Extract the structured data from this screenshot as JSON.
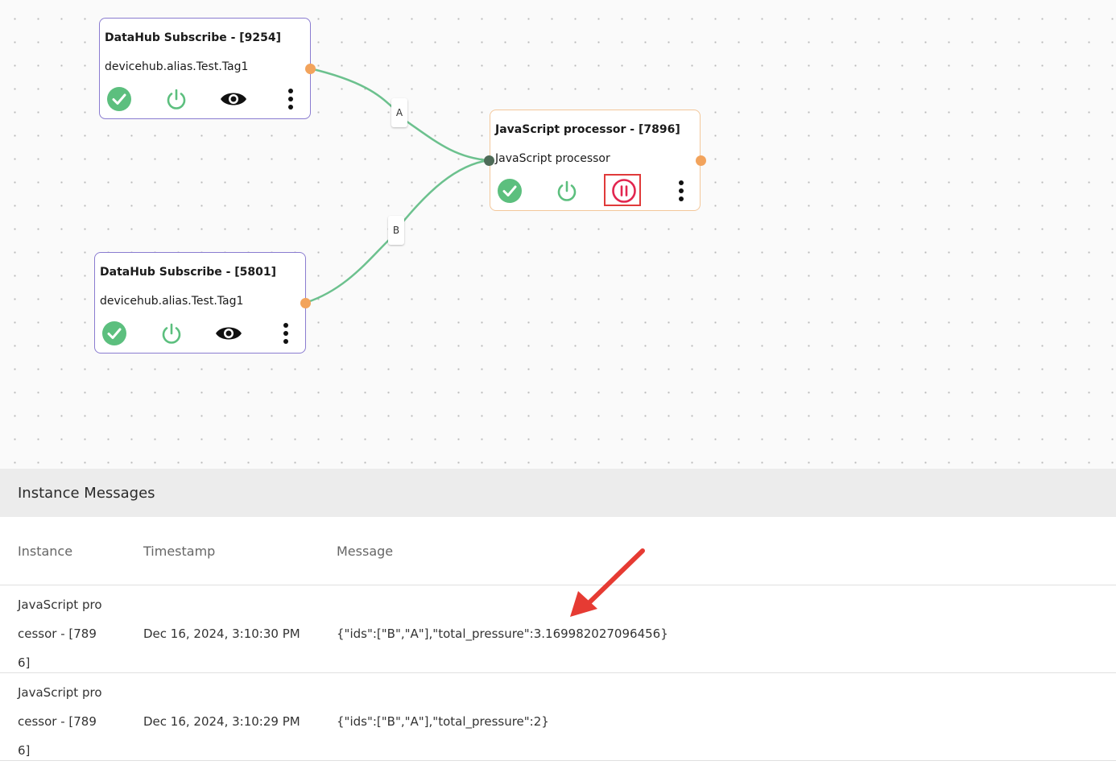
{
  "flow": {
    "nodes": [
      {
        "title": "DataHub Subscribe - [9254]",
        "subtitle": "devicehub.alias.Test.Tag1",
        "actions": [
          "check-icon",
          "power-icon",
          "eye-icon",
          "more-vertical-icon"
        ]
      },
      {
        "title": "JavaScript processor - [7896]",
        "subtitle": "JavaScript processor",
        "actions": [
          "check-icon",
          "power-icon",
          "pause-icon",
          "more-vertical-icon"
        ]
      },
      {
        "title": "DataHub Subscribe - [5801]",
        "subtitle": "devicehub.alias.Test.Tag1",
        "actions": [
          "check-icon",
          "power-icon",
          "eye-icon",
          "more-vertical-icon"
        ]
      }
    ],
    "edges": [
      {
        "label": "A"
      },
      {
        "label": "B"
      }
    ],
    "colors": {
      "status_ok": "#5cbf7e",
      "power": "#5cbf7e",
      "pause": "#e2264f",
      "wire": "#6cc18e",
      "output_port": "#f2a35c",
      "input_port": "#4e6b58",
      "subscribe_border": "#8a7cd0",
      "processor_border": "#f3c79a",
      "highlight": "#e03a3a"
    }
  },
  "messages": {
    "title": "Instance Messages",
    "columns": [
      "Instance",
      "Timestamp",
      "Message"
    ],
    "rows": [
      {
        "instance": "JavaScript processor - [7896]",
        "timestamp": "Dec 16, 2024, 3:10:30 PM",
        "message": "{\"ids\":[\"B\",\"A\"],\"total_pressure\":3.169982027096456}"
      },
      {
        "instance": "JavaScript processor - [7896]",
        "timestamp": "Dec 16, 2024, 3:10:29 PM",
        "message": "{\"ids\":[\"B\",\"A\"],\"total_pressure\":2}"
      }
    ]
  }
}
